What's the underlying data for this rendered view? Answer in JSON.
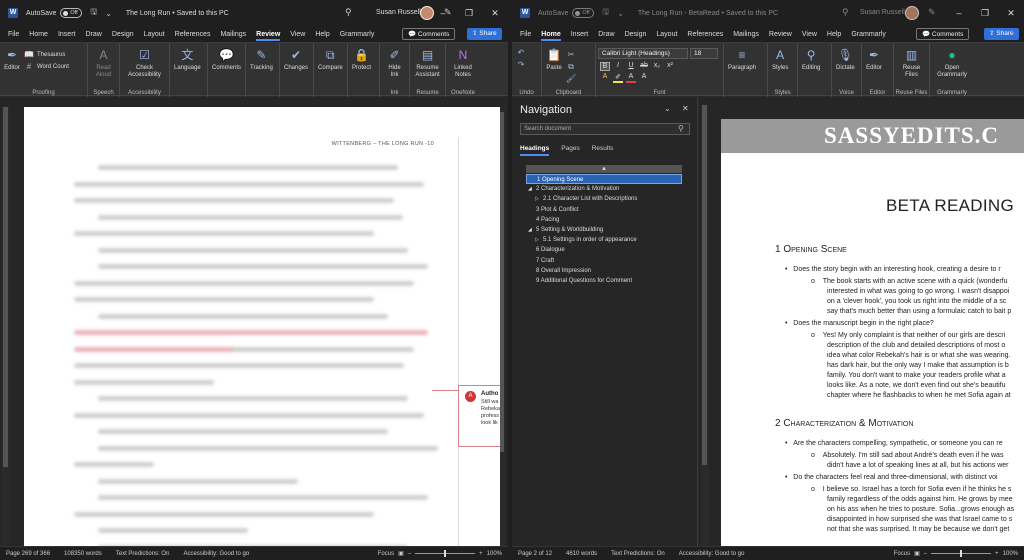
{
  "left": {
    "autosave_label": "AutoSave",
    "autosave_state": "Off",
    "doc_title": "The Long Run • Saved to this PC",
    "user_name": "Susan Russell",
    "menu": [
      "File",
      "Home",
      "Insert",
      "Draw",
      "Design",
      "Layout",
      "References",
      "Mailings",
      "Review",
      "View",
      "Help",
      "Grammarly"
    ],
    "active_menu": "Review",
    "comments_label": "Comments",
    "share_label": "Share",
    "ribbon": {
      "proofing": {
        "label": "Proofing",
        "editor": "Editor",
        "thesaurus": "Thesaurus",
        "word_count": "Word Count"
      },
      "speech": {
        "label": "Speech",
        "read_aloud": "Read Aloud"
      },
      "accessibility": {
        "label": "Accessibility",
        "check": "Check Accessibility"
      },
      "language": {
        "label": "Language"
      },
      "comments": {
        "label": "Comments"
      },
      "tracking": {
        "label": "Tracking"
      },
      "changes": {
        "label": "Changes"
      },
      "compare": {
        "label": "Compare"
      },
      "protect": {
        "label": "Protect"
      },
      "ink": {
        "label": "Ink",
        "hide_ink": "Hide Ink"
      },
      "resume": {
        "label": "Resume",
        "assistant": "Resume Assistant"
      },
      "onenote": {
        "label": "OneNote",
        "linked": "Linked Notes"
      }
    },
    "page_header": "WITTENBERG – THE LONG RUN -10",
    "comment_author": "Autho",
    "comment_lines": [
      "Still wa",
      "Rebeka",
      "profess",
      "look lik"
    ],
    "status": {
      "page": "Page 269 of 366",
      "words": "108350 words",
      "predictions": "Text Predictions: On",
      "accessibility": "Accessibility: Good to go",
      "focus": "Focus",
      "zoom": "100%"
    }
  },
  "right": {
    "autosave_label": "AutoSave",
    "autosave_state": "Off",
    "doc_title": "The Long Run - BetaRead • Saved to this PC",
    "user_name": "Susan Russell",
    "menu": [
      "File",
      "Home",
      "Insert",
      "Draw",
      "Design",
      "Layout",
      "References",
      "Mailings",
      "Review",
      "View",
      "Help",
      "Grammarly"
    ],
    "active_menu": "Home",
    "comments_label": "Comments",
    "share_label": "Share",
    "ribbon": {
      "undo": {
        "label": "Undo"
      },
      "clipboard": {
        "label": "Clipboard",
        "paste": "Paste"
      },
      "font": {
        "label": "Font",
        "name": "Calibri Light (Headings)",
        "size": "18",
        "format": [
          "B",
          "I",
          "U",
          "ab",
          "x₂",
          "x²",
          "A",
          "A",
          "A"
        ]
      },
      "paragraph": {
        "label": "Paragraph"
      },
      "styles": {
        "label": "Styles",
        "styles": "Styles"
      },
      "editing": {
        "label": "Editing"
      },
      "voice": {
        "label": "Voice",
        "dictate": "Dictate"
      },
      "editor": {
        "label": "Editor",
        "editor": "Editor"
      },
      "reuse": {
        "label": "Reuse Files",
        "reuse": "Reuse Files"
      },
      "grammarly": {
        "label": "Grammarly",
        "open": "Open Grammarly"
      }
    },
    "navigation": {
      "title": "Navigation",
      "search_placeholder": "Search document",
      "tabs": [
        "Headings",
        "Pages",
        "Results"
      ],
      "items": [
        {
          "text": "1 Opening Scene",
          "level": 0,
          "selected": true,
          "arrow": ""
        },
        {
          "text": "2 Characterization & Motivation",
          "level": 0,
          "selected": false,
          "arrow": "◢"
        },
        {
          "text": "2.1 Character List with Descriptions",
          "level": 1,
          "selected": false,
          "arrow": "▷"
        },
        {
          "text": "3 Plot & Conflict",
          "level": 0,
          "selected": false,
          "arrow": ""
        },
        {
          "text": "4 Pacing",
          "level": 0,
          "selected": false,
          "arrow": ""
        },
        {
          "text": "5 Setting & Worldbuilding",
          "level": 0,
          "selected": false,
          "arrow": "◢"
        },
        {
          "text": "5.1 Settings in order of appearance",
          "level": 1,
          "selected": false,
          "arrow": "▷"
        },
        {
          "text": "6 Dialogue",
          "level": 0,
          "selected": false,
          "arrow": ""
        },
        {
          "text": "7 Craft",
          "level": 0,
          "selected": false,
          "arrow": ""
        },
        {
          "text": "8 Overall Impression",
          "level": 0,
          "selected": false,
          "arrow": ""
        },
        {
          "text": "9 Additional Questions for Comment",
          "level": 0,
          "selected": false,
          "arrow": ""
        }
      ]
    },
    "doc": {
      "banner": "SASSYEDITS.C",
      "title": "BETA READING",
      "h1": "1  Opening Scene",
      "b1": "Does the story begin with an interesting hook, creating a desire to r",
      "b1a": [
        "The book starts with an active scene with a quick (wonderfu",
        "interested in what was going to go wrong. I wasn't disappoi",
        "on a 'clever hook', you took us right into the middle of a sc",
        "say that's much better than using a formulaic catch to bait p"
      ],
      "b2": "Does the manuscript begin in the right place?",
      "b2a": [
        "Yes! My only complaint is that neither of our girls are descri",
        "description of the club and detailed descriptions of most o",
        "idea what color Rebekah's hair is or what she was wearing.",
        "has dark hair, but the only way I make that assumption is b",
        "family. You don't want to make your readers profile what a",
        "looks like. As a note, we don't even find out she's beautifu",
        "chapter where he flashbacks to when he met Sofia again at"
      ],
      "h2": "2  Characterization & Motivation",
      "b3": "Are the characters compelling, sympathetic, or someone you can re",
      "b3a": [
        "Absolutely. I'm still sad about André's death even if he was",
        "didn't have a lot of speaking lines at all, but his actions wer"
      ],
      "b4": "Do the characters feel real and three-dimensional, with distinct voi",
      "b4a": [
        "I believe so. Israel has a torch for Sofia even if he thinks he s",
        "family regardless of the odds against him.  He grows by mee",
        "on his ass when he tries to posture. Sofia...grows enough as",
        "disappointed in how surprised she was that Israel came to s",
        "not that she was surprised. It may be because we don't get"
      ]
    },
    "status": {
      "page": "Page 2 of 12",
      "words": "4610 words",
      "predictions": "Text Predictions: On",
      "accessibility": "Accessibility: Good to go",
      "focus": "Focus",
      "zoom": "100%"
    }
  }
}
